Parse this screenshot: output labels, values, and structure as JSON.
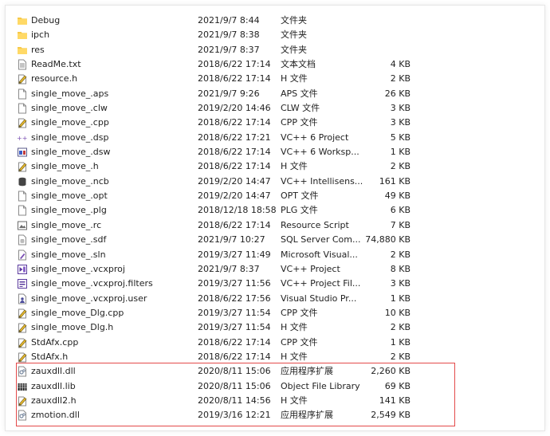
{
  "files": [
    {
      "name": "Debug",
      "date": "2021/9/7 8:44",
      "type": "文件夹",
      "size": "",
      "icon": "folder-icon"
    },
    {
      "name": "ipch",
      "date": "2021/9/7 8:38",
      "type": "文件夹",
      "size": "",
      "icon": "folder-icon"
    },
    {
      "name": "res",
      "date": "2021/9/7 8:37",
      "type": "文件夹",
      "size": "",
      "icon": "folder-icon"
    },
    {
      "name": "ReadMe.txt",
      "date": "2018/6/22 17:14",
      "type": "文本文档",
      "size": "4 KB",
      "icon": "text-file-icon"
    },
    {
      "name": "resource.h",
      "date": "2018/6/22 17:14",
      "type": "H 文件",
      "size": "2 KB",
      "icon": "source-file-icon"
    },
    {
      "name": "single_move_.aps",
      "date": "2021/9/7 9:26",
      "type": "APS 文件",
      "size": "26 KB",
      "icon": "blank-file-icon"
    },
    {
      "name": "single_move_.clw",
      "date": "2019/2/20 14:46",
      "type": "CLW 文件",
      "size": "3 KB",
      "icon": "blank-file-icon"
    },
    {
      "name": "single_move_.cpp",
      "date": "2018/6/22 17:14",
      "type": "CPP 文件",
      "size": "3 KB",
      "icon": "source-file-icon"
    },
    {
      "name": "single_move_.dsp",
      "date": "2018/6/22 17:21",
      "type": "VC++ 6 Project",
      "size": "5 KB",
      "icon": "vc6-project-icon"
    },
    {
      "name": "single_move_.dsw",
      "date": "2018/6/22 17:14",
      "type": "VC++ 6 Worksp...",
      "size": "1 KB",
      "icon": "vc6-workspace-icon"
    },
    {
      "name": "single_move_.h",
      "date": "2018/6/22 17:14",
      "type": "H 文件",
      "size": "2 KB",
      "icon": "source-file-icon"
    },
    {
      "name": "single_move_.ncb",
      "date": "2019/2/20 14:47",
      "type": "VC++ Intellisens...",
      "size": "161 KB",
      "icon": "database-icon"
    },
    {
      "name": "single_move_.opt",
      "date": "2019/2/20 14:47",
      "type": "OPT 文件",
      "size": "49 KB",
      "icon": "blank-file-icon"
    },
    {
      "name": "single_move_.plg",
      "date": "2018/12/18 18:58",
      "type": "PLG 文件",
      "size": "6 KB",
      "icon": "blank-file-icon"
    },
    {
      "name": "single_move_.rc",
      "date": "2018/6/22 17:14",
      "type": "Resource Script",
      "size": "7 KB",
      "icon": "resource-script-icon"
    },
    {
      "name": "single_move_.sdf",
      "date": "2021/9/7 10:27",
      "type": "SQL Server Com...",
      "size": "74,880 KB",
      "icon": "sql-file-icon"
    },
    {
      "name": "single_move_.sln",
      "date": "2019/3/27 11:49",
      "type": "Microsoft Visual...",
      "size": "2 KB",
      "icon": "solution-file-icon"
    },
    {
      "name": "single_move_.vcxproj",
      "date": "2021/9/7 8:37",
      "type": "VC++ Project",
      "size": "8 KB",
      "icon": "vcxproj-icon"
    },
    {
      "name": "single_move_.vcxproj.filters",
      "date": "2019/3/27 11:56",
      "type": "VC++ Project Fil...",
      "size": "3 KB",
      "icon": "vcxproj-filters-icon"
    },
    {
      "name": "single_move_.vcxproj.user",
      "date": "2018/6/22 17:56",
      "type": "Visual Studio Pr...",
      "size": "1 KB",
      "icon": "vs-user-file-icon"
    },
    {
      "name": "single_move_Dlg.cpp",
      "date": "2019/3/27 11:54",
      "type": "CPP 文件",
      "size": "10 KB",
      "icon": "source-file-icon"
    },
    {
      "name": "single_move_Dlg.h",
      "date": "2019/3/27 11:54",
      "type": "H 文件",
      "size": "2 KB",
      "icon": "source-file-icon"
    },
    {
      "name": "StdAfx.cpp",
      "date": "2018/6/22 17:14",
      "type": "CPP 文件",
      "size": "1 KB",
      "icon": "source-file-icon"
    },
    {
      "name": "StdAfx.h",
      "date": "2018/6/22 17:14",
      "type": "H 文件",
      "size": "2 KB",
      "icon": "source-file-icon"
    },
    {
      "name": "zauxdll.dll",
      "date": "2020/8/11 15:06",
      "type": "应用程序扩展",
      "size": "2,260 KB",
      "icon": "dll-file-icon"
    },
    {
      "name": "zauxdll.lib",
      "date": "2020/8/11 15:06",
      "type": "Object File Library",
      "size": "69 KB",
      "icon": "lib-file-icon"
    },
    {
      "name": "zauxdll2.h",
      "date": "2020/8/11 14:56",
      "type": "H 文件",
      "size": "141 KB",
      "icon": "source-file-icon"
    },
    {
      "name": "zmotion.dll",
      "date": "2019/3/16 12:21",
      "type": "应用程序扩展",
      "size": "2,549 KB",
      "icon": "dll-file-icon"
    }
  ],
  "highlight_color": "#e34a4a",
  "folder_color": "#f7c948"
}
